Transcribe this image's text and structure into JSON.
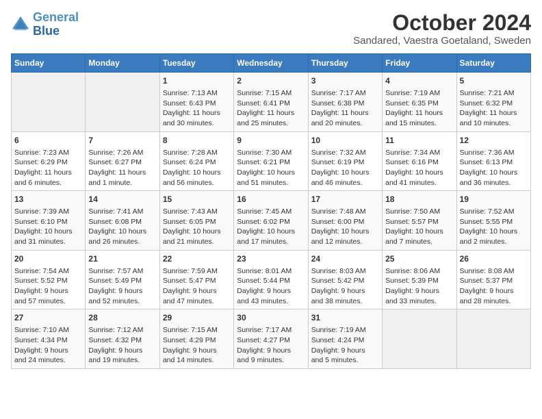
{
  "header": {
    "logo_line1": "General",
    "logo_line2": "Blue",
    "title": "October 2024",
    "subtitle": "Sandared, Vaestra Goetaland, Sweden"
  },
  "weekdays": [
    "Sunday",
    "Monday",
    "Tuesday",
    "Wednesday",
    "Thursday",
    "Friday",
    "Saturday"
  ],
  "weeks": [
    [
      {
        "day": "",
        "info": ""
      },
      {
        "day": "",
        "info": ""
      },
      {
        "day": "1",
        "info": "Sunrise: 7:13 AM\nSunset: 6:43 PM\nDaylight: 11 hours\nand 30 minutes."
      },
      {
        "day": "2",
        "info": "Sunrise: 7:15 AM\nSunset: 6:41 PM\nDaylight: 11 hours\nand 25 minutes."
      },
      {
        "day": "3",
        "info": "Sunrise: 7:17 AM\nSunset: 6:38 PM\nDaylight: 11 hours\nand 20 minutes."
      },
      {
        "day": "4",
        "info": "Sunrise: 7:19 AM\nSunset: 6:35 PM\nDaylight: 11 hours\nand 15 minutes."
      },
      {
        "day": "5",
        "info": "Sunrise: 7:21 AM\nSunset: 6:32 PM\nDaylight: 11 hours\nand 10 minutes."
      }
    ],
    [
      {
        "day": "6",
        "info": "Sunrise: 7:23 AM\nSunset: 6:29 PM\nDaylight: 11 hours\nand 6 minutes."
      },
      {
        "day": "7",
        "info": "Sunrise: 7:26 AM\nSunset: 6:27 PM\nDaylight: 11 hours\nand 1 minute."
      },
      {
        "day": "8",
        "info": "Sunrise: 7:28 AM\nSunset: 6:24 PM\nDaylight: 10 hours\nand 56 minutes."
      },
      {
        "day": "9",
        "info": "Sunrise: 7:30 AM\nSunset: 6:21 PM\nDaylight: 10 hours\nand 51 minutes."
      },
      {
        "day": "10",
        "info": "Sunrise: 7:32 AM\nSunset: 6:19 PM\nDaylight: 10 hours\nand 46 minutes."
      },
      {
        "day": "11",
        "info": "Sunrise: 7:34 AM\nSunset: 6:16 PM\nDaylight: 10 hours\nand 41 minutes."
      },
      {
        "day": "12",
        "info": "Sunrise: 7:36 AM\nSunset: 6:13 PM\nDaylight: 10 hours\nand 36 minutes."
      }
    ],
    [
      {
        "day": "13",
        "info": "Sunrise: 7:39 AM\nSunset: 6:10 PM\nDaylight: 10 hours\nand 31 minutes."
      },
      {
        "day": "14",
        "info": "Sunrise: 7:41 AM\nSunset: 6:08 PM\nDaylight: 10 hours\nand 26 minutes."
      },
      {
        "day": "15",
        "info": "Sunrise: 7:43 AM\nSunset: 6:05 PM\nDaylight: 10 hours\nand 21 minutes."
      },
      {
        "day": "16",
        "info": "Sunrise: 7:45 AM\nSunset: 6:02 PM\nDaylight: 10 hours\nand 17 minutes."
      },
      {
        "day": "17",
        "info": "Sunrise: 7:48 AM\nSunset: 6:00 PM\nDaylight: 10 hours\nand 12 minutes."
      },
      {
        "day": "18",
        "info": "Sunrise: 7:50 AM\nSunset: 5:57 PM\nDaylight: 10 hours\nand 7 minutes."
      },
      {
        "day": "19",
        "info": "Sunrise: 7:52 AM\nSunset: 5:55 PM\nDaylight: 10 hours\nand 2 minutes."
      }
    ],
    [
      {
        "day": "20",
        "info": "Sunrise: 7:54 AM\nSunset: 5:52 PM\nDaylight: 9 hours\nand 57 minutes."
      },
      {
        "day": "21",
        "info": "Sunrise: 7:57 AM\nSunset: 5:49 PM\nDaylight: 9 hours\nand 52 minutes."
      },
      {
        "day": "22",
        "info": "Sunrise: 7:59 AM\nSunset: 5:47 PM\nDaylight: 9 hours\nand 47 minutes."
      },
      {
        "day": "23",
        "info": "Sunrise: 8:01 AM\nSunset: 5:44 PM\nDaylight: 9 hours\nand 43 minutes."
      },
      {
        "day": "24",
        "info": "Sunrise: 8:03 AM\nSunset: 5:42 PM\nDaylight: 9 hours\nand 38 minutes."
      },
      {
        "day": "25",
        "info": "Sunrise: 8:06 AM\nSunset: 5:39 PM\nDaylight: 9 hours\nand 33 minutes."
      },
      {
        "day": "26",
        "info": "Sunrise: 8:08 AM\nSunset: 5:37 PM\nDaylight: 9 hours\nand 28 minutes."
      }
    ],
    [
      {
        "day": "27",
        "info": "Sunrise: 7:10 AM\nSunset: 4:34 PM\nDaylight: 9 hours\nand 24 minutes."
      },
      {
        "day": "28",
        "info": "Sunrise: 7:12 AM\nSunset: 4:32 PM\nDaylight: 9 hours\nand 19 minutes."
      },
      {
        "day": "29",
        "info": "Sunrise: 7:15 AM\nSunset: 4:29 PM\nDaylight: 9 hours\nand 14 minutes."
      },
      {
        "day": "30",
        "info": "Sunrise: 7:17 AM\nSunset: 4:27 PM\nDaylight: 9 hours\nand 9 minutes."
      },
      {
        "day": "31",
        "info": "Sunrise: 7:19 AM\nSunset: 4:24 PM\nDaylight: 9 hours\nand 5 minutes."
      },
      {
        "day": "",
        "info": ""
      },
      {
        "day": "",
        "info": ""
      }
    ]
  ]
}
